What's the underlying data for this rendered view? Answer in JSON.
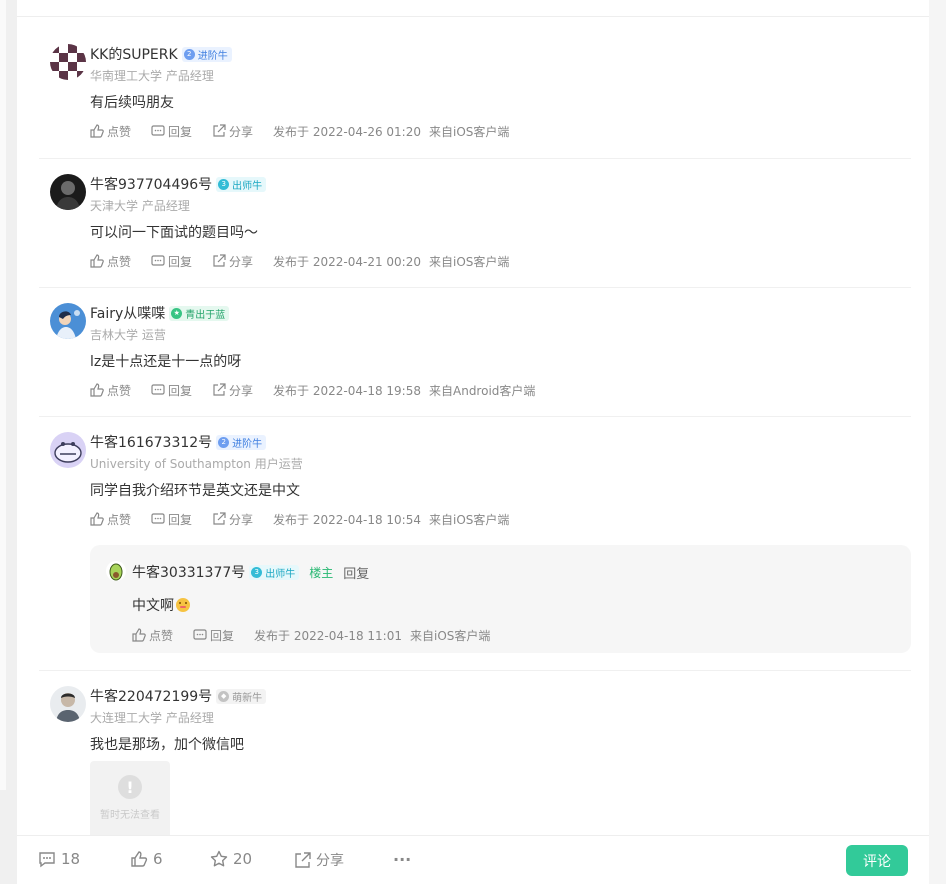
{
  "comments": [
    {
      "username": "KK的SUPERK",
      "badge": "进阶牛",
      "badge_level": "2",
      "subtitle": "华南理工大学 产品经理",
      "text": "有后续吗朋友",
      "like": "点赞",
      "reply": "回复",
      "share": "分享",
      "posted": "发布于 2022-04-26 01:20",
      "source": "来自iOS客户端"
    },
    {
      "username": "牛客937704496号",
      "badge": "出师牛",
      "badge_level": "3",
      "subtitle": "天津大学 产品经理",
      "text": "可以问一下面试的题目吗～",
      "like": "点赞",
      "reply": "回复",
      "share": "分享",
      "posted": "发布于 2022-04-21 00:20",
      "source": "来自iOS客户端"
    },
    {
      "username": "Fairy从喋喋",
      "badge": "青出于蓝",
      "badge_level": "",
      "subtitle": "吉林大学 运营",
      "text": "lz是十点还是十一点的呀",
      "like": "点赞",
      "reply": "回复",
      "share": "分享",
      "posted": "发布于 2022-04-18 19:58",
      "source": "来自Android客户端"
    },
    {
      "username": "牛客161673312号",
      "badge": "进阶牛",
      "badge_level": "2",
      "subtitle": "University of Southampton 用户运营",
      "text": "同学自我介绍环节是英文还是中文",
      "like": "点赞",
      "reply": "回复",
      "share": "分享",
      "posted": "发布于 2022-04-18 10:54",
      "source": "来自iOS客户端"
    },
    {
      "username": "牛客220472199号",
      "badge": "萌新牛",
      "badge_level": "",
      "subtitle": "大连理工大学 产品经理",
      "text": "我也是那场，加个微信吧",
      "image_placeholder": "暂时无法查看"
    }
  ],
  "nested_reply": {
    "username": "牛客30331377号",
    "badge": "出师牛",
    "badge_level": "3",
    "op_tag": "楼主",
    "reply_label": "回复",
    "text": "中文啊",
    "like": "点赞",
    "reply": "回复",
    "posted": "发布于 2022-04-18 11:01",
    "source": "来自iOS客户端"
  },
  "bottom_bar": {
    "comments_count": "18",
    "likes_count": "6",
    "favorites_count": "20",
    "share_label": "分享",
    "more_label": "···",
    "comment_button": "评论"
  },
  "colors": {
    "accent": "#32ca99",
    "op_tag": "#28b872"
  }
}
